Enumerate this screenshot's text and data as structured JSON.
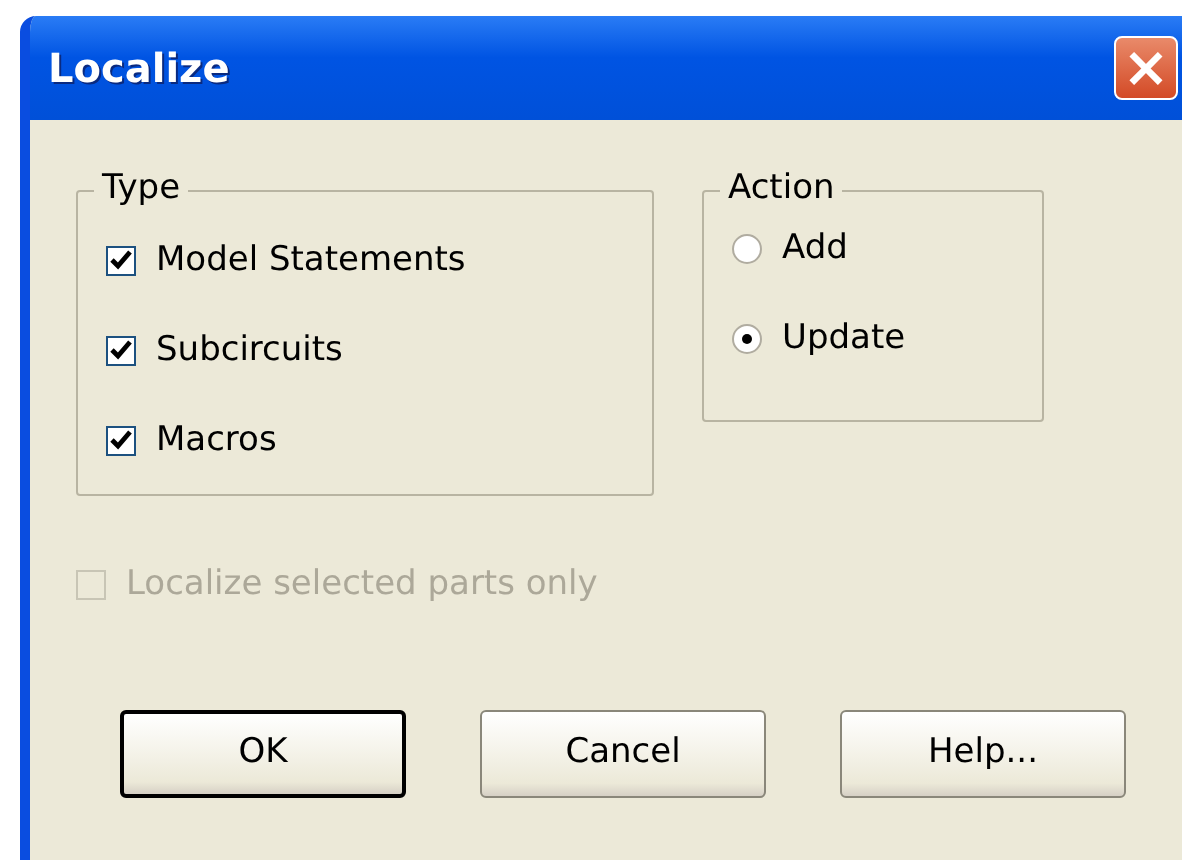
{
  "window": {
    "title": "Localize",
    "close_label": "×"
  },
  "type_group": {
    "label": "Type",
    "options": [
      {
        "label": "Model Statements",
        "checked": true
      },
      {
        "label": "Subcircuits",
        "checked": true
      },
      {
        "label": "Macros",
        "checked": true
      }
    ]
  },
  "action_group": {
    "label": "Action",
    "options": [
      {
        "label": "Add",
        "selected": false
      },
      {
        "label": "Update",
        "selected": true
      }
    ]
  },
  "selected_only": {
    "label": "Localize selected parts only",
    "checked": false,
    "disabled": true
  },
  "buttons": [
    {
      "label": "OK",
      "default": true
    },
    {
      "label": "Cancel",
      "default": false
    },
    {
      "label": "Help...",
      "default": false
    }
  ]
}
